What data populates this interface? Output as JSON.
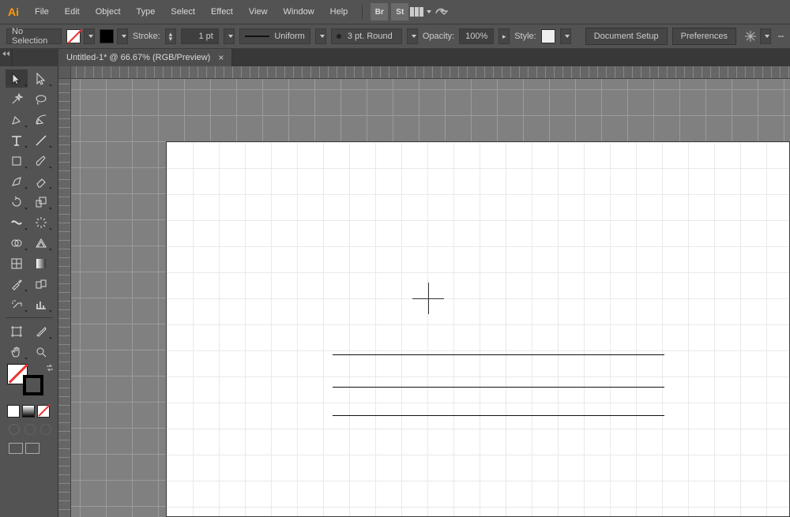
{
  "app": {
    "logo_text": "Ai"
  },
  "menu": {
    "items": [
      "File",
      "Edit",
      "Object",
      "Type",
      "Select",
      "Effect",
      "View",
      "Window",
      "Help"
    ],
    "right_badges": [
      "Br",
      "St"
    ]
  },
  "controlbar": {
    "selection": "No Selection",
    "stroke_label": "Stroke:",
    "stroke_weight": "1 pt",
    "profile_label": "Uniform",
    "brush_label": "3 pt. Round",
    "opacity_label": "Opacity:",
    "opacity_value": "100%",
    "style_label": "Style:",
    "doc_setup": "Document Setup",
    "preferences": "Preferences"
  },
  "tab": {
    "title": "Untitled-1* @ 66.67% (RGB/Preview)"
  },
  "tools": [
    [
      "selection",
      "direct-selection"
    ],
    [
      "magic-wand",
      "lasso"
    ],
    [
      "pen",
      "curvature"
    ],
    [
      "type",
      "line-segment"
    ],
    [
      "rectangle",
      "paintbrush"
    ],
    [
      "shaper",
      "eraser"
    ],
    [
      "rotate",
      "scale"
    ],
    [
      "width",
      "free-transform"
    ],
    [
      "shape-builder",
      "perspective-grid"
    ],
    [
      "mesh",
      "gradient"
    ],
    [
      "eyedropper",
      "blend"
    ],
    [
      "symbol-sprayer",
      "column-graph"
    ],
    [
      "artboard",
      "slice"
    ],
    [
      "hand",
      "zoom"
    ]
  ]
}
